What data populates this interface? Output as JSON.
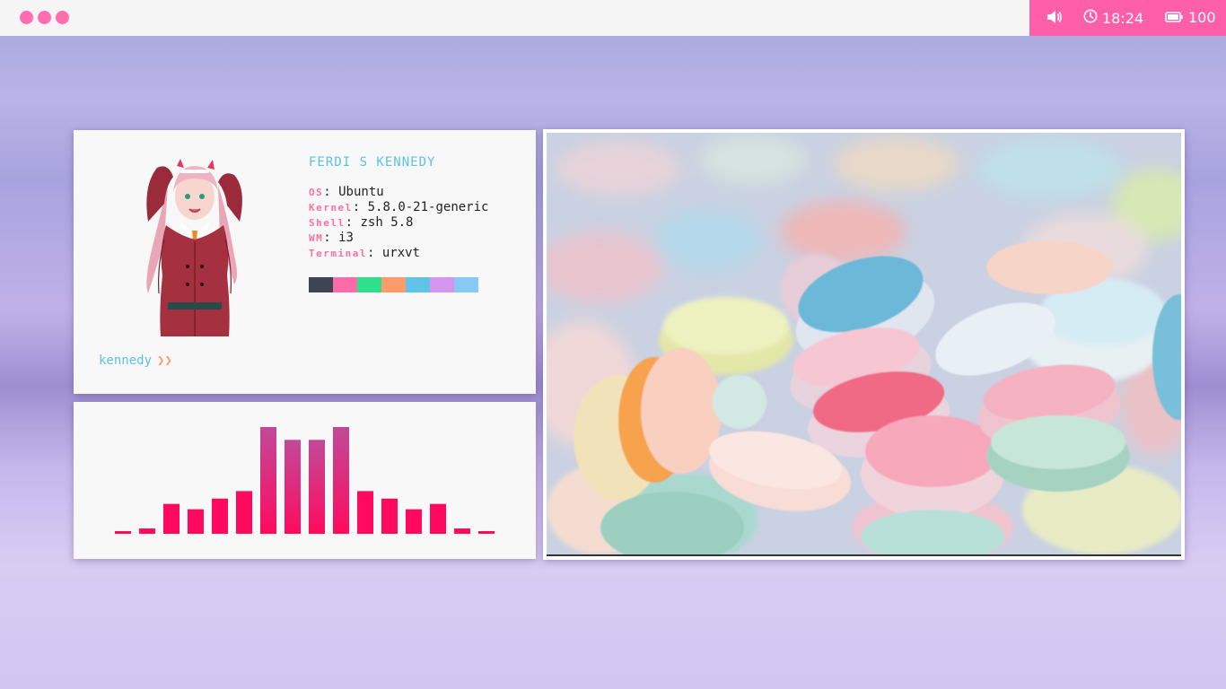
{
  "topbar": {
    "workspaces": [
      {
        "id": "1"
      },
      {
        "id": "2"
      },
      {
        "id": "3"
      }
    ],
    "status": {
      "volume_icon": "speaker-icon",
      "clock_icon": "clock-icon",
      "time": "18:24",
      "battery_icon": "battery-icon",
      "battery": "100",
      "color": "#ff5fa8"
    }
  },
  "info": {
    "name": "FERDI S KENNEDY",
    "fields": [
      {
        "label": "OS",
        "value": "Ubuntu"
      },
      {
        "label": "Kernel",
        "value": "5.8.0-21-generic"
      },
      {
        "label": "Shell",
        "value": "zsh 5.8"
      },
      {
        "label": "WM",
        "value": "i3"
      },
      {
        "label": "Terminal",
        "value": "urxvt"
      }
    ],
    "palette": [
      "#3f4455",
      "#ff6aa8",
      "#2ee08c",
      "#ff9a6a",
      "#5fc4e8",
      "#d596f0",
      "#86c9f5"
    ],
    "prompt": "kennedy",
    "prompt_arrow": "❯❯"
  },
  "visualizer": {
    "levels": [
      0.02,
      0.05,
      0.28,
      0.23,
      0.33,
      0.4,
      1.0,
      0.88,
      0.88,
      1.0,
      0.4,
      0.33,
      0.23,
      0.28,
      0.05,
      0.02
    ],
    "colors": {
      "top": "#c04a98",
      "bottom": "#ff0a5e"
    }
  }
}
